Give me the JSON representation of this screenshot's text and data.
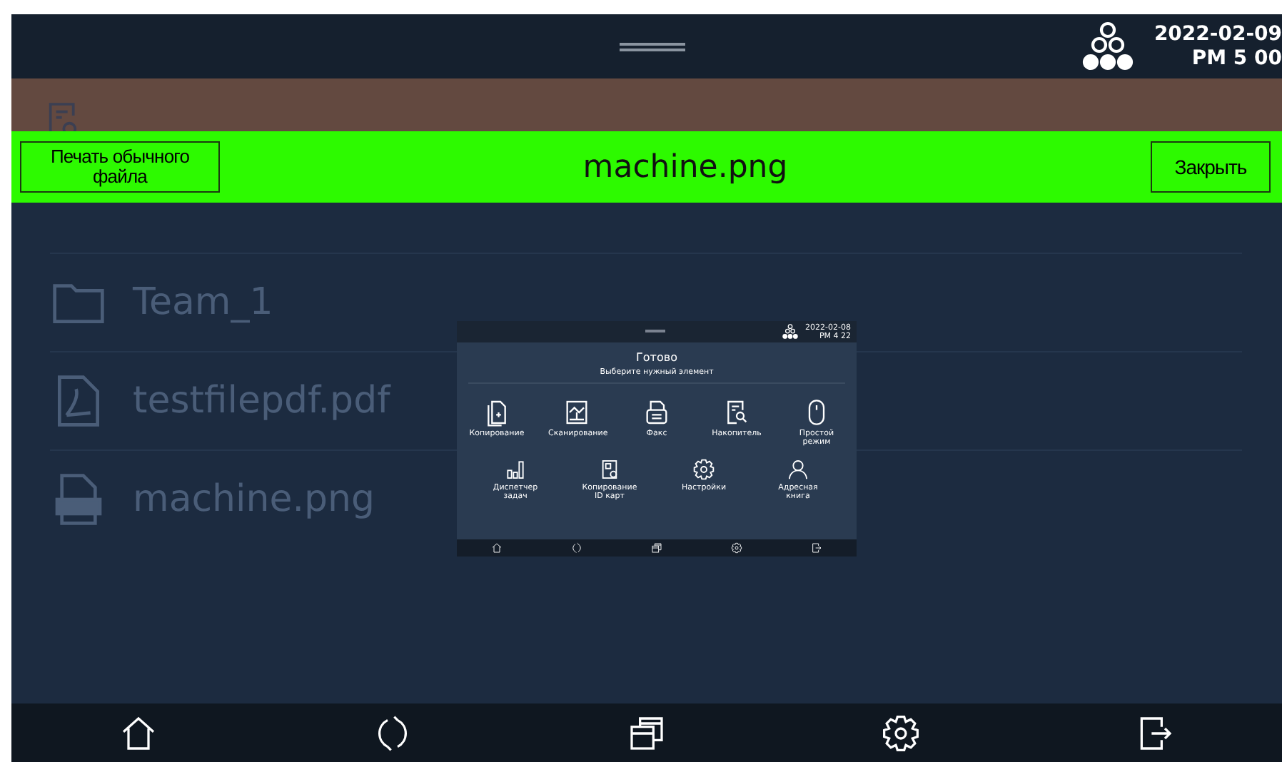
{
  "status_bar": {
    "date": "2022-02-09",
    "time": "PM 5 00"
  },
  "viewer": {
    "print_button": "Печать обычного файла",
    "file_name": "machine.png",
    "close_button": "Закрыть"
  },
  "files": [
    {
      "kind": "folder",
      "name": "Team_1"
    },
    {
      "kind": "pdf",
      "name": "testfilepdf.pdf"
    },
    {
      "kind": "png",
      "name": "machine.png"
    }
  ],
  "preview": {
    "date": "2022-02-08",
    "time": "PM 4 22",
    "title": "Готово",
    "subtitle": "Выберите нужный элемент",
    "apps": [
      {
        "kind": "copy",
        "label": "Копирование"
      },
      {
        "kind": "scan",
        "label": "Сканирование"
      },
      {
        "kind": "fax",
        "label": "Факс"
      },
      {
        "kind": "storage",
        "label": "Накопитель"
      },
      {
        "kind": "simple",
        "label": "Простой режим"
      },
      {
        "kind": "jobs",
        "label": "Диспетчер задач"
      },
      {
        "kind": "idcopy",
        "label": "Копирование ID карт"
      },
      {
        "kind": "settings",
        "label": "Настройки"
      },
      {
        "kind": "contacts",
        "label": "Адресная книга"
      }
    ]
  }
}
